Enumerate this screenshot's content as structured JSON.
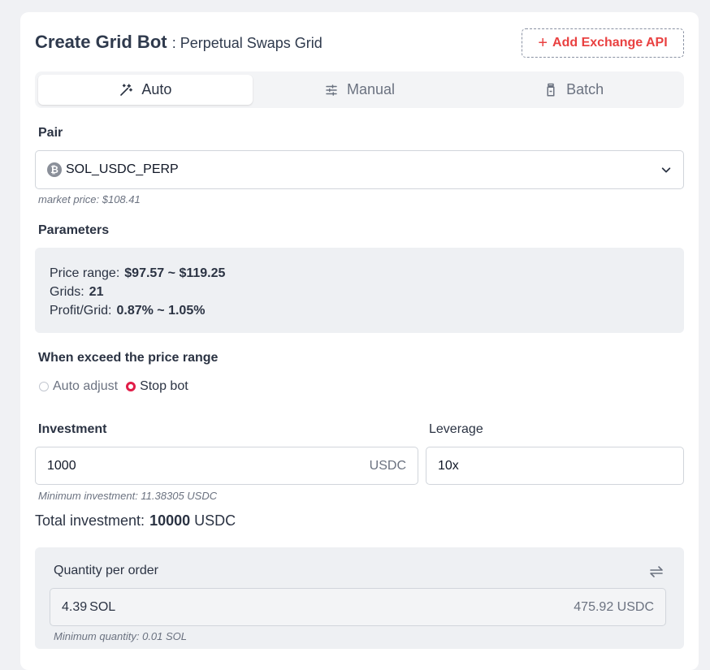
{
  "header": {
    "title": "Create Grid Bot",
    "subtitle": ": Perpetual Swaps Grid",
    "add_api_label": "Add Exchange API"
  },
  "tabs": [
    {
      "label": "Auto",
      "icon": "magic-wand-icon",
      "active": true
    },
    {
      "label": "Manual",
      "icon": "sliders-icon",
      "active": false
    },
    {
      "label": "Batch",
      "icon": "jar-icon",
      "active": false
    }
  ],
  "pair": {
    "label": "Pair",
    "value": "SOL_USDC_PERP",
    "market_price": "market price: $108.41"
  },
  "parameters": {
    "label": "Parameters",
    "price_range_label": "Price range:",
    "price_range_value": "$97.57 ~ $119.25",
    "grids_label": "Grids:",
    "grids_value": "21",
    "profit_label": "Profit/Grid:",
    "profit_value": "0.87% ~ 1.05%"
  },
  "exceed": {
    "label": "When exceed the price range",
    "options": [
      "Auto adjust",
      "Stop bot"
    ],
    "selected": "Stop bot"
  },
  "investment": {
    "label": "Investment",
    "value": "1000",
    "unit": "USDC",
    "minimum": "Minimum investment: 11.38305 USDC"
  },
  "leverage": {
    "label": "Leverage",
    "value": "10x"
  },
  "total": {
    "label": "Total investment:",
    "value": "10000",
    "unit": "USDC"
  },
  "quantity": {
    "label": "Quantity per order",
    "value": "4.39",
    "unit": "SOL",
    "quote": "475.92 USDC",
    "minimum": "Minimum quantity: 0.01 SOL"
  },
  "colors": {
    "accent_red": "#e94141",
    "radio_selected": "#e11d48",
    "panel_bg": "#eef0f3"
  }
}
